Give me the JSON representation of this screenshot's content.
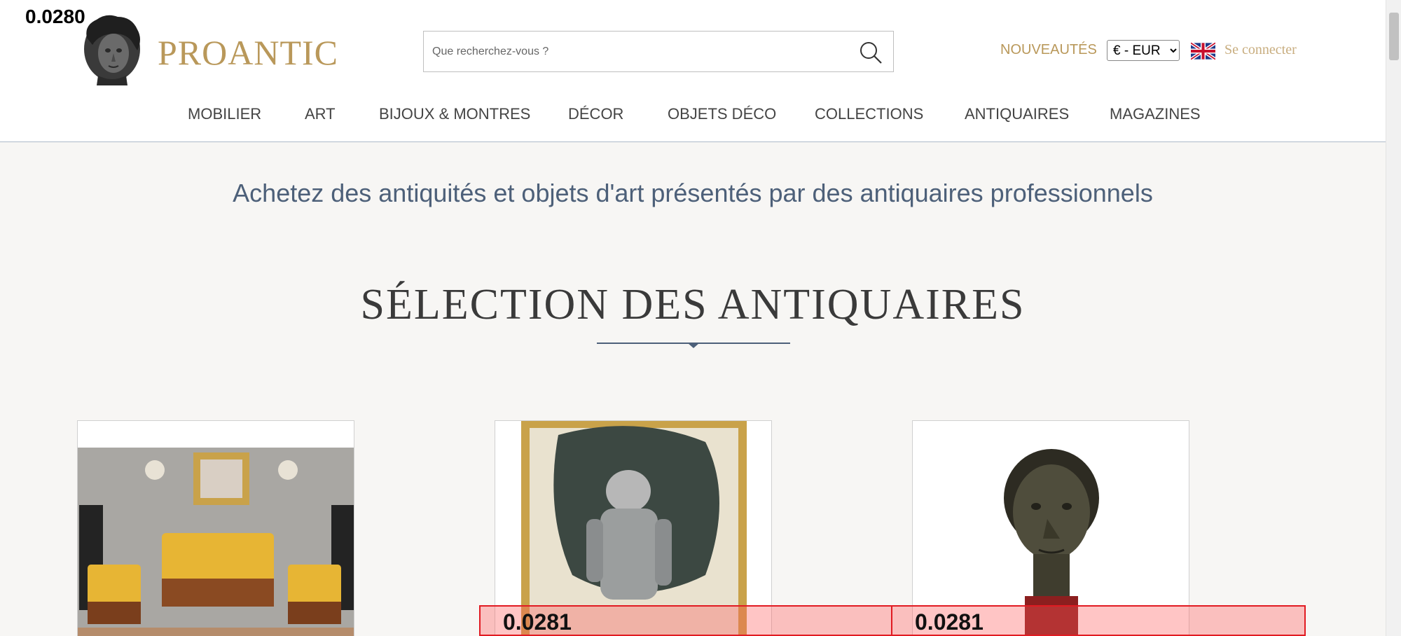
{
  "overlay_value": "0.0280",
  "logo": {
    "text": "PROANTIC"
  },
  "search": {
    "placeholder": "Que recherchez-vous ?"
  },
  "header": {
    "nouveautes": "NOUVEAUTÉS",
    "currency_selected": "€ - EUR",
    "connect": "Se connecter"
  },
  "nav": {
    "items": [
      {
        "label": "MOBILIER"
      },
      {
        "label": "ART"
      },
      {
        "label": "BIJOUX & MONTRES"
      },
      {
        "label": "DÉCOR"
      },
      {
        "label": "OBJETS DÉCO"
      },
      {
        "label": "COLLECTIONS"
      },
      {
        "label": "ANTIQUAIRES"
      },
      {
        "label": "MAGAZINES"
      }
    ]
  },
  "tagline": "Achetez des antiquités et objets d'art présentés par des antiquaires professionnels",
  "section": {
    "title": "SÉLECTION DES ANTIQUAIRES"
  },
  "detections": [
    {
      "label": "0.0281"
    },
    {
      "label": "0.0281"
    }
  ],
  "colors": {
    "gold": "#b9985a",
    "navy": "#4d6079",
    "detect": "#e11b22"
  }
}
